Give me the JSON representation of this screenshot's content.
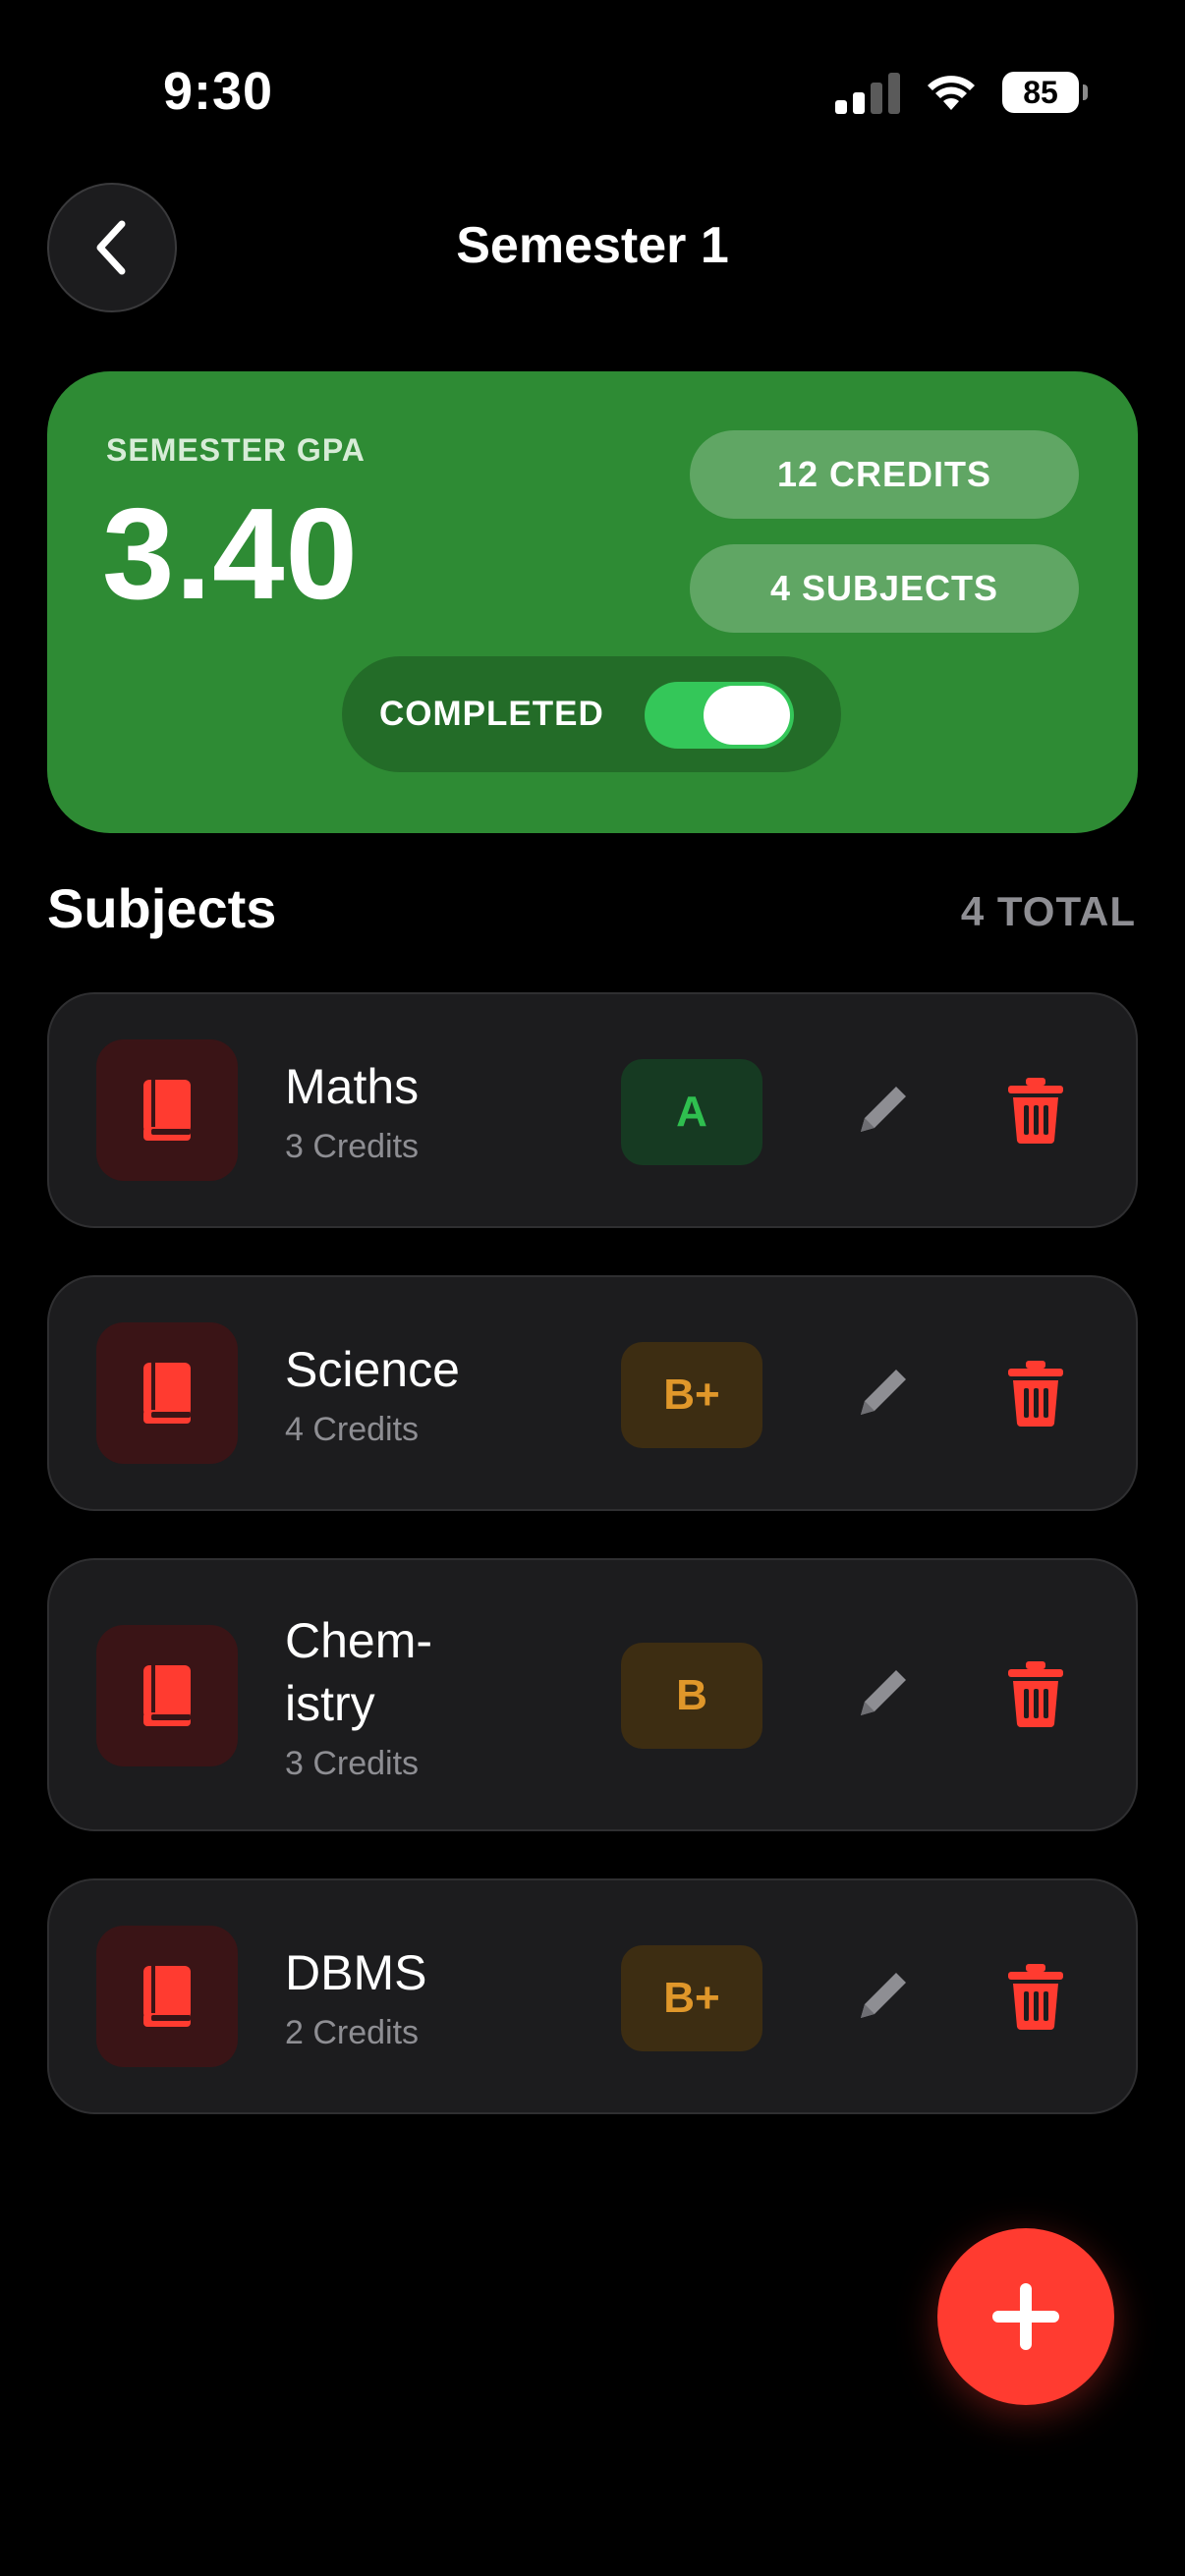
{
  "status_bar": {
    "time": "9:30",
    "battery": "85"
  },
  "header": {
    "title": "Semester 1"
  },
  "summary": {
    "gpa_label": "SEMESTER GPA",
    "gpa_value": "3.40",
    "credits_pill": "12 CREDITS",
    "subjects_pill": "4 SUBJECTS",
    "completed_label": "COMPLETED",
    "completed_on": true,
    "accent_color": "#2e8b34"
  },
  "subjects_section": {
    "title": "Subjects",
    "count_label": "4 TOTAL"
  },
  "subjects": [
    {
      "name": "Maths",
      "credits": "3 Credits",
      "grade": "A",
      "grade_color": "#2fbf4f"
    },
    {
      "name": "Science",
      "credits": "4 Credits",
      "grade": "B+",
      "grade_color": "#e0972a"
    },
    {
      "name": "Chem-\nistry",
      "credits": "3 Credits",
      "grade": "B",
      "grade_color": "#e0972a"
    },
    {
      "name": "DBMS",
      "credits": "2 Credits",
      "grade": "B+",
      "grade_color": "#e0972a"
    }
  ],
  "icons": {
    "back": "chevron-left-icon",
    "subject": "book-icon",
    "edit": "pencil-icon",
    "delete": "trash-icon",
    "add": "plus-icon"
  }
}
